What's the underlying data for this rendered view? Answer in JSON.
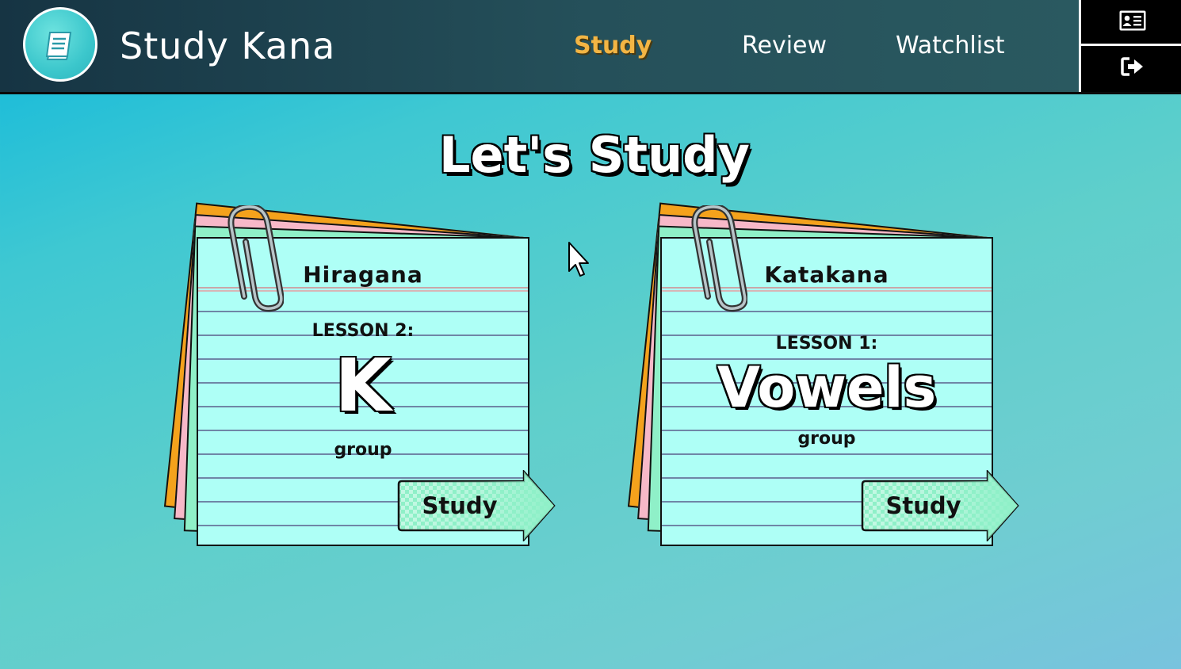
{
  "app": {
    "title": "Study Kana"
  },
  "nav": {
    "items": [
      {
        "label": "Study",
        "active": true
      },
      {
        "label": "Review",
        "active": false
      },
      {
        "label": "Watchlist",
        "active": false
      }
    ]
  },
  "side_buttons": {
    "profile_icon": "id-card-icon",
    "logout_icon": "sign-out-icon"
  },
  "main": {
    "heading": "Let's Study"
  },
  "cards": [
    {
      "title": "Hiragana",
      "lesson": "LESSON 2:",
      "group_name": "K",
      "group_suffix": "group",
      "button": "Study"
    },
    {
      "title": "Katakana",
      "lesson": "LESSON 1:",
      "group_name": "Vowels",
      "group_suffix": "group",
      "button": "Study"
    }
  ],
  "colors": {
    "accent": "#f3b544",
    "card": "#aefff6",
    "button": "#8ff0c8",
    "paper_orange": "#f4a21c",
    "paper_pink": "#f7b8c8"
  }
}
